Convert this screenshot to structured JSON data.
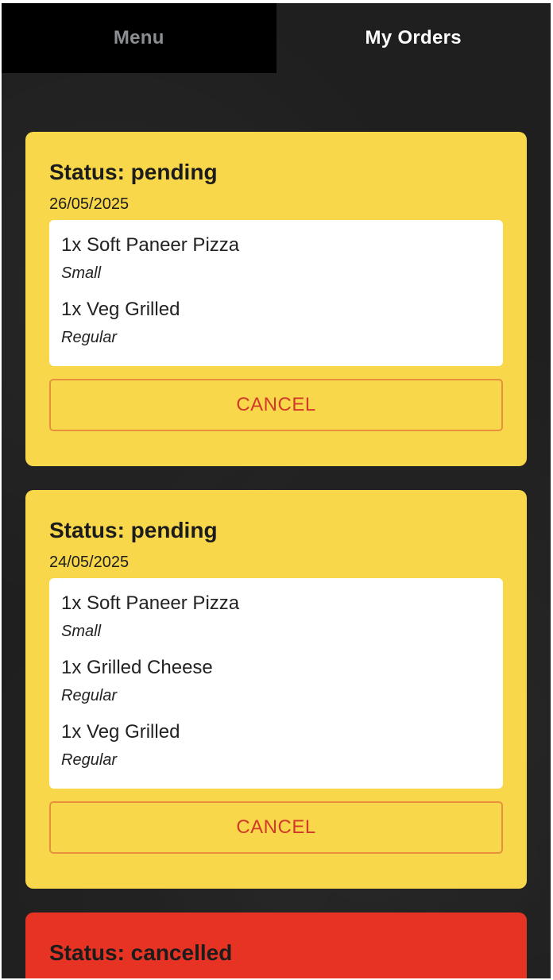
{
  "tabs": {
    "menu": "Menu",
    "my_orders": "My Orders"
  },
  "orders": [
    {
      "status": "Status: pending",
      "date": "26/05/2025",
      "items": [
        {
          "name": "1x Soft Paneer Pizza",
          "size": "Small"
        },
        {
          "name": "1x Veg Grilled",
          "size": "Regular"
        }
      ],
      "cancel_label": "CANCEL"
    },
    {
      "status": "Status: pending",
      "date": "24/05/2025",
      "items": [
        {
          "name": "1x Soft Paneer Pizza",
          "size": "Small"
        },
        {
          "name": "1x Grilled Cheese",
          "size": "Regular"
        },
        {
          "name": "1x Veg Grilled",
          "size": "Regular"
        }
      ],
      "cancel_label": "CANCEL"
    },
    {
      "status": "Status: cancelled"
    }
  ],
  "colors": {
    "pending_card": "#f8d84a",
    "cancelled_card": "#e63323",
    "cancel_text": "#d13a2a",
    "cancel_border": "#e8903e",
    "background": "#1f1f1f",
    "active_tab_text": "#ffffff",
    "inactive_tab_text": "#8b8e92"
  }
}
